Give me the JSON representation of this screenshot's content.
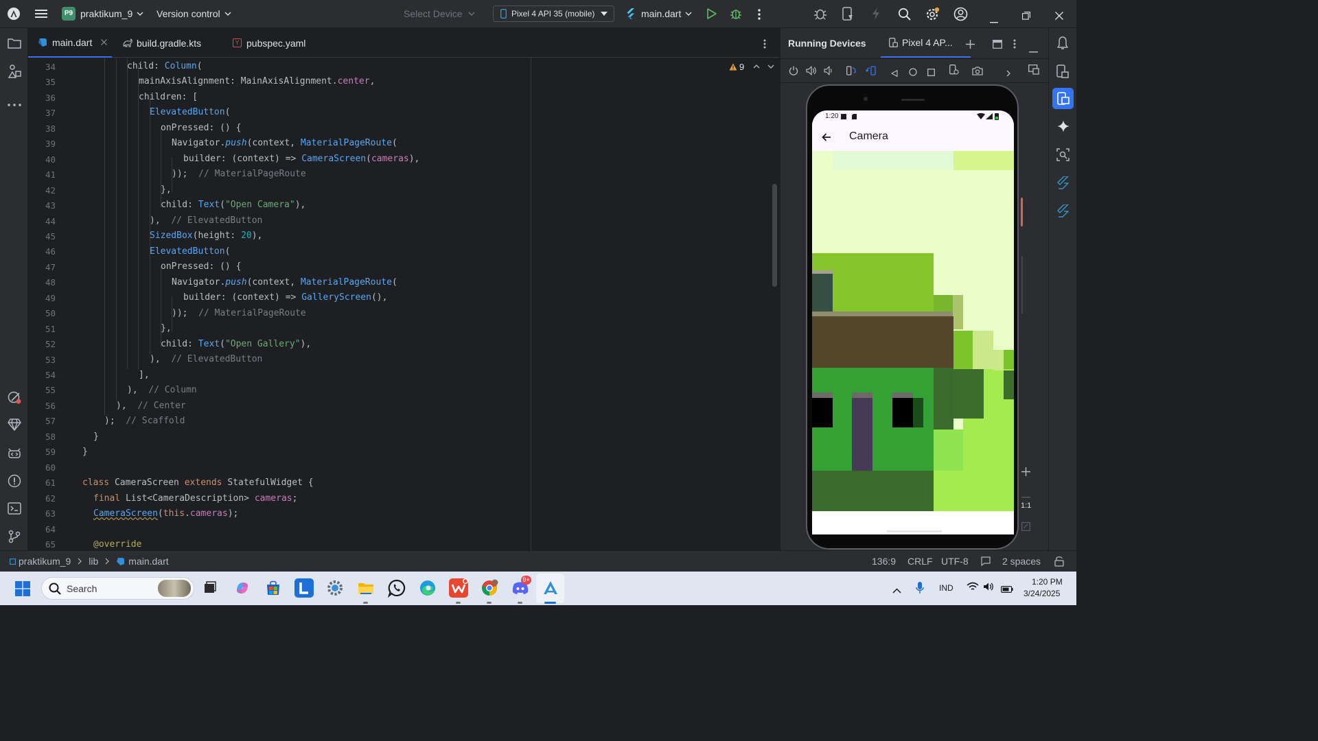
{
  "titlebar": {
    "project_badge": "P9",
    "project_name": "praktikum_9",
    "vcs": "Version control",
    "select_device": "Select Device",
    "device": "Pixel 4 API 35 (mobile)",
    "run_config": "main.dart"
  },
  "tabs": [
    {
      "label": "main.dart",
      "active": true
    },
    {
      "label": "build.gradle.kts"
    },
    {
      "label": "pubspec.yaml"
    }
  ],
  "editor": {
    "warning_count": "9",
    "line_numbers": [
      "34",
      "35",
      "36",
      "37",
      "38",
      "39",
      "40",
      "41",
      "42",
      "43",
      "44",
      "45",
      "46",
      "47",
      "48",
      "49",
      "50",
      "51",
      "52",
      "53",
      "54",
      "55",
      "56",
      "57",
      "58",
      "59",
      "60",
      "61",
      "62",
      "63",
      "64",
      "65"
    ]
  },
  "code": {
    "l34": {
      "a": "child: ",
      "b": "Column",
      "c": "("
    },
    "l35": {
      "a": "mainAxisAlignment: MainAxisAlignment.",
      "b": "center",
      "c": ","
    },
    "l36": {
      "a": "children: ["
    },
    "l37": {
      "a": "ElevatedButton",
      "b": "("
    },
    "l38": {
      "a": "onPressed: () {"
    },
    "l39": {
      "a": "Navigator.",
      "b": "push",
      "c": "(context, ",
      "d": "MaterialPageRoute",
      "e": "("
    },
    "l40": {
      "a": "builder: (context) => ",
      "b": "CameraScreen",
      "c": "(",
      "d": "cameras",
      "e": "),"
    },
    "l41": {
      "a": "));",
      "b": "// MaterialPageRoute"
    },
    "l42": {
      "a": "},"
    },
    "l43": {
      "a": "child: ",
      "b": "Text",
      "c": "(",
      "d": "\"Open Camera\"",
      "e": "),"
    },
    "l44": {
      "a": "),",
      "b": "// ElevatedButton"
    },
    "l45": {
      "a": "SizedBox",
      "b": "(height: ",
      "c": "20",
      "d": "),"
    },
    "l46": {
      "a": "ElevatedButton",
      "b": "("
    },
    "l47": {
      "a": "onPressed: () {"
    },
    "l48": {
      "a": "Navigator.",
      "b": "push",
      "c": "(context, ",
      "d": "MaterialPageRoute",
      "e": "("
    },
    "l49": {
      "a": "builder: (context) => ",
      "b": "GalleryScreen",
      "c": "(),"
    },
    "l50": {
      "a": "));",
      "b": "// MaterialPageRoute"
    },
    "l51": {
      "a": "},"
    },
    "l52": {
      "a": "child: ",
      "b": "Text",
      "c": "(",
      "d": "\"Open Gallery\"",
      "e": "),"
    },
    "l53": {
      "a": "),",
      "b": "// ElevatedButton"
    },
    "l54": {
      "a": "],"
    },
    "l55": {
      "a": "),",
      "b": "// Column"
    },
    "l56": {
      "a": "),",
      "b": "// Center"
    },
    "l57": {
      "a": ");",
      "b": "// Scaffold"
    },
    "l58": {
      "a": "}"
    },
    "l59": {
      "a": "}"
    },
    "l61": {
      "a": "class ",
      "b": "CameraScreen ",
      "c": "extends ",
      "d": "StatefulWidget {"
    },
    "l62": {
      "a": "final ",
      "b": "List<CameraDescription> ",
      "c": "cameras",
      "d": ";"
    },
    "l63": {
      "a": "CameraScreen",
      "b": "(",
      "c": "this",
      "d": ".",
      "e": "cameras",
      "f": ");"
    },
    "l65": {
      "a": "@override"
    }
  },
  "running_devices": {
    "title": "Running Devices",
    "device_tab": "Pixel 4 AP...",
    "zoom_label": "1:1"
  },
  "phone": {
    "status_time": "1:20",
    "app_title": "Camera"
  },
  "statusbar": {
    "crumb_project": "praktikum_9",
    "crumb_dir": "lib",
    "crumb_file": "main.dart",
    "position": "136:9",
    "line_sep": "CRLF",
    "encoding": "UTF-8",
    "indent": "2 spaces"
  },
  "taskbar": {
    "search_placeholder": "Search",
    "lang": "IND",
    "time": "1:20 PM",
    "date": "3/24/2025",
    "discord_badge": "9+"
  }
}
